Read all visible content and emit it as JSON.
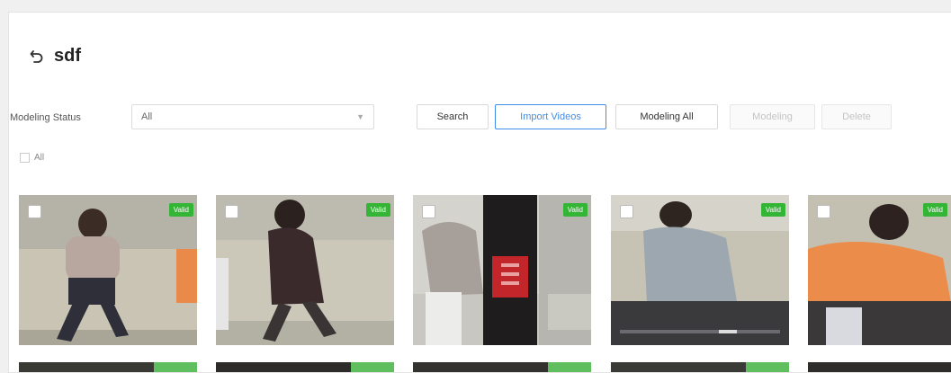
{
  "header": {
    "title": "sdf"
  },
  "filters": {
    "modeling_status_label": "Modeling Status",
    "modeling_status_value": "All"
  },
  "toolbar": {
    "search": "Search",
    "import_videos": "Import Videos",
    "modeling_all": "Modeling All",
    "modeling": "Modeling",
    "delete": "Delete"
  },
  "select_all_label": "All",
  "videos": [
    {
      "status": "Valid"
    },
    {
      "status": "Valid"
    },
    {
      "status": "Valid"
    },
    {
      "status": "Valid"
    },
    {
      "status": "Valid"
    }
  ],
  "colors": {
    "accent": "#3f8dea",
    "valid_badge": "#35b535"
  }
}
